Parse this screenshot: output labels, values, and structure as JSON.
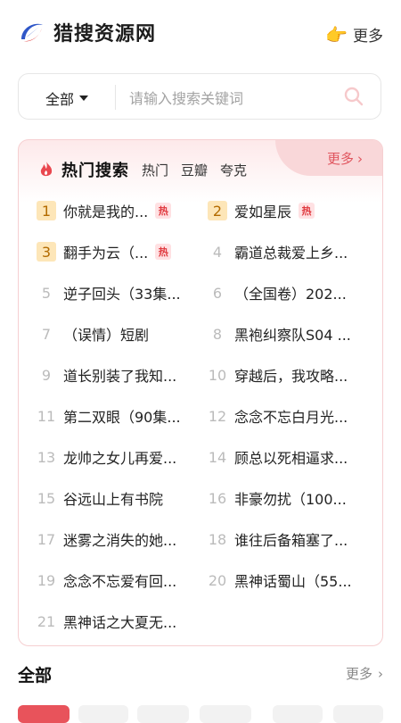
{
  "header": {
    "brand": "猎搜资源网",
    "more_label": "更多",
    "colors": {
      "brand_blue": "#2f57c8",
      "brand_red": "#e03a3a"
    }
  },
  "search": {
    "scope_label": "全部",
    "placeholder": "请输入搜索关键词"
  },
  "hot": {
    "title": "热门搜索",
    "tabs": [
      "热门",
      "豆瓣",
      "夸克"
    ],
    "more_label": "更多",
    "badge_label": "热",
    "items": [
      {
        "rank": "1",
        "title": "你就是我的...",
        "hot": true
      },
      {
        "rank": "2",
        "title": "爱如星辰",
        "hot": true
      },
      {
        "rank": "3",
        "title": "翻手为云（...",
        "hot": true
      },
      {
        "rank": "4",
        "title": "霸道总裁爱上乡...",
        "hot": false
      },
      {
        "rank": "5",
        "title": "逆子回头（33集...",
        "hot": false
      },
      {
        "rank": "6",
        "title": "（全国卷）202...",
        "hot": false
      },
      {
        "rank": "7",
        "title": "（误情）短剧",
        "hot": false
      },
      {
        "rank": "8",
        "title": "黑袍纠察队S04 ...",
        "hot": false
      },
      {
        "rank": "9",
        "title": "道长别装了我知...",
        "hot": false
      },
      {
        "rank": "10",
        "title": "穿越后，我攻略...",
        "hot": false
      },
      {
        "rank": "11",
        "title": "第二双眼（90集...",
        "hot": false
      },
      {
        "rank": "12",
        "title": "念念不忘白月光...",
        "hot": false
      },
      {
        "rank": "13",
        "title": "龙帅之女儿再爱...",
        "hot": false
      },
      {
        "rank": "14",
        "title": "顾总以死相逼求...",
        "hot": false
      },
      {
        "rank": "15",
        "title": "谷远山上有书院",
        "hot": false
      },
      {
        "rank": "16",
        "title": "非豪勿扰（100...",
        "hot": false
      },
      {
        "rank": "17",
        "title": "迷雾之消失的她...",
        "hot": false
      },
      {
        "rank": "18",
        "title": "谁往后备箱塞了...",
        "hot": false
      },
      {
        "rank": "19",
        "title": "念念不忘爱有回...",
        "hot": false
      },
      {
        "rank": "20",
        "title": "黑神话蜀山（55...",
        "hot": false
      },
      {
        "rank": "21",
        "title": "黑神话之大夏无...",
        "hot": false
      }
    ],
    "colors": {
      "accent": "#e0555e",
      "top_rank_bg": "#fde6b8"
    }
  },
  "all": {
    "title": "全部",
    "more_label": "更多"
  }
}
